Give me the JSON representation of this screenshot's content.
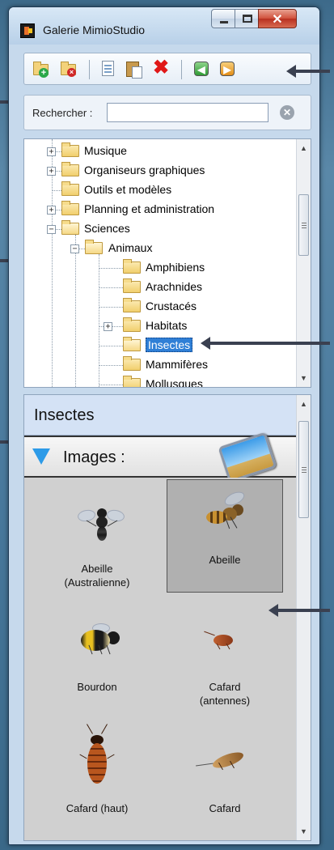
{
  "window": {
    "title": "Galerie MimioStudio"
  },
  "search": {
    "label": "Rechercher :",
    "value": "",
    "placeholder": ""
  },
  "tree": {
    "items": [
      {
        "label": "Musique",
        "level": 1,
        "expander": "+"
      },
      {
        "label": "Organiseurs graphiques",
        "level": 1,
        "expander": "+"
      },
      {
        "label": "Outils et modèles",
        "level": 1,
        "expander": ""
      },
      {
        "label": "Planning et administration",
        "level": 1,
        "expander": "+"
      },
      {
        "label": "Sciences",
        "level": 1,
        "expander": "-"
      },
      {
        "label": "Animaux",
        "level": 2,
        "expander": "-"
      },
      {
        "label": "Amphibiens",
        "level": 3,
        "expander": ""
      },
      {
        "label": "Arachnides",
        "level": 3,
        "expander": ""
      },
      {
        "label": "Crustacés",
        "level": 3,
        "expander": ""
      },
      {
        "label": "Habitats",
        "level": 3,
        "expander": "+"
      },
      {
        "label": "Insectes",
        "level": 3,
        "expander": "",
        "selected": true
      },
      {
        "label": "Mammifères",
        "level": 3,
        "expander": ""
      },
      {
        "label": "Mollusques",
        "level": 3,
        "expander": ""
      }
    ]
  },
  "gallery": {
    "title": "Insectes",
    "section_label": "Images :",
    "items": [
      {
        "label": "Abeille\n(Australienne)",
        "selected": false
      },
      {
        "label": "Abeille",
        "selected": true
      },
      {
        "label": "Bourdon",
        "selected": false
      },
      {
        "label": "Cafard\n(antennes)",
        "selected": false
      },
      {
        "label": "Cafard (haut)",
        "selected": false
      },
      {
        "label": "Cafard",
        "selected": false
      }
    ]
  },
  "colors": {
    "selection": "#2f7fd6",
    "section_header_bg": "#d4e2f5",
    "gallery_bg": "#d0d0d0",
    "expand_triangle": "#2d9be8"
  },
  "icons": {
    "toolbar": [
      "new-folder-icon",
      "delete-folder-icon",
      "copy-icon",
      "paste-icon",
      "delete-icon",
      "import-icon",
      "export-icon"
    ],
    "search": "clear-search-icon",
    "section": "images-icon"
  }
}
